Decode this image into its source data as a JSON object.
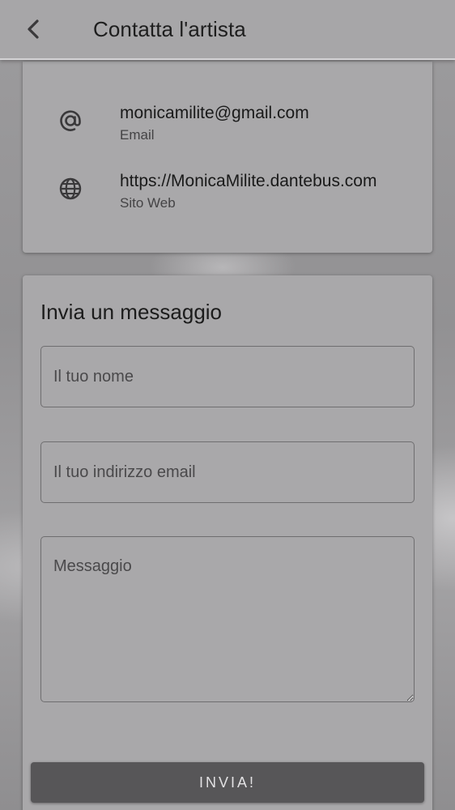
{
  "header": {
    "title": "Contatta l'artista",
    "back_icon": "chevron-left-icon"
  },
  "contacts": [
    {
      "icon": "at-sign-icon",
      "value": "monicamilite@gmail.com",
      "label": "Email"
    },
    {
      "icon": "globe-icon",
      "value": "https://MonicaMilite.dantebus.com",
      "label": "Sito Web"
    }
  ],
  "message_form": {
    "title": "Invia un messaggio",
    "name_placeholder": "Il tuo nome",
    "email_placeholder": "Il tuo indirizzo email",
    "message_placeholder": "Messaggio",
    "submit_label": "INVIA!"
  },
  "colors": {
    "header_bg": "#a7a6a8",
    "card_bg": "#a9a8aa",
    "button_bg": "#575658",
    "button_text": "#e2e1e3"
  }
}
